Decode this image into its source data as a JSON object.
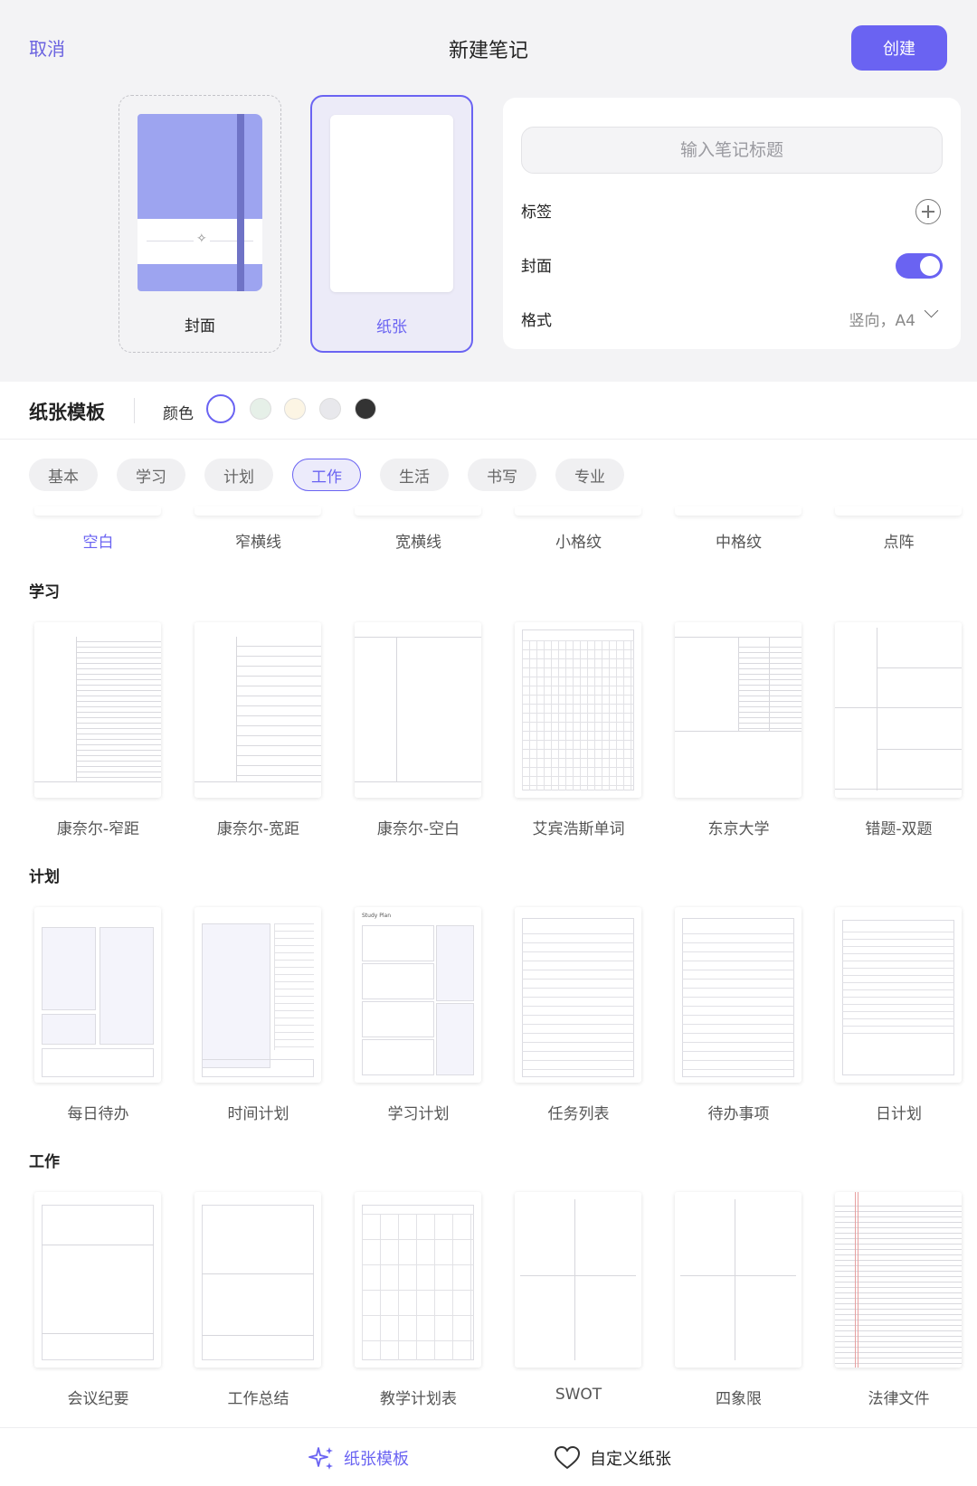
{
  "header": {
    "cancel_label": "取消",
    "title": "新建笔记",
    "create_label": "创建"
  },
  "choices": {
    "cover_label": "封面",
    "paper_label": "纸张"
  },
  "panel": {
    "title_placeholder": "输入笔记标题",
    "tags_label": "标签",
    "cover_label": "封面",
    "cover_enabled": true,
    "format_label": "格式",
    "format_value": "竖向，A4"
  },
  "templates": {
    "title": "纸张模板",
    "color_label": "颜色",
    "colors": [
      "#ffffff",
      "#e6f0e8",
      "#fcf5e4",
      "#e8e8ec",
      "#333333"
    ],
    "selected_color": "#ffffff",
    "categories": [
      "基本",
      "学习",
      "计划",
      "工作",
      "生活",
      "书写",
      "专业"
    ],
    "active_category": "工作",
    "basic": [
      "空白",
      "窄横线",
      "宽横线",
      "小格纹",
      "中格纹",
      "点阵"
    ],
    "selected_basic": "空白",
    "sections": [
      {
        "title": "学习",
        "items": [
          "康奈尔-窄距",
          "康奈尔-宽距",
          "康奈尔-空白",
          "艾宾浩斯单词",
          "东京大学",
          "错题-双题"
        ]
      },
      {
        "title": "计划",
        "items": [
          "每日待办",
          "时间计划",
          "学习计划",
          "任务列表",
          "待办事项",
          "日计划"
        ]
      },
      {
        "title": "工作",
        "items": [
          "会议纪要",
          "工作总结",
          "教学计划表",
          "SWOT",
          "四象限",
          "法律文件"
        ]
      }
    ],
    "thumb_text": {
      "study_plan": "Study Plan"
    }
  },
  "bottom_bar": {
    "templates_label": "纸张模板",
    "custom_label": "自定义纸张"
  },
  "accent_color": "#6a63f2"
}
